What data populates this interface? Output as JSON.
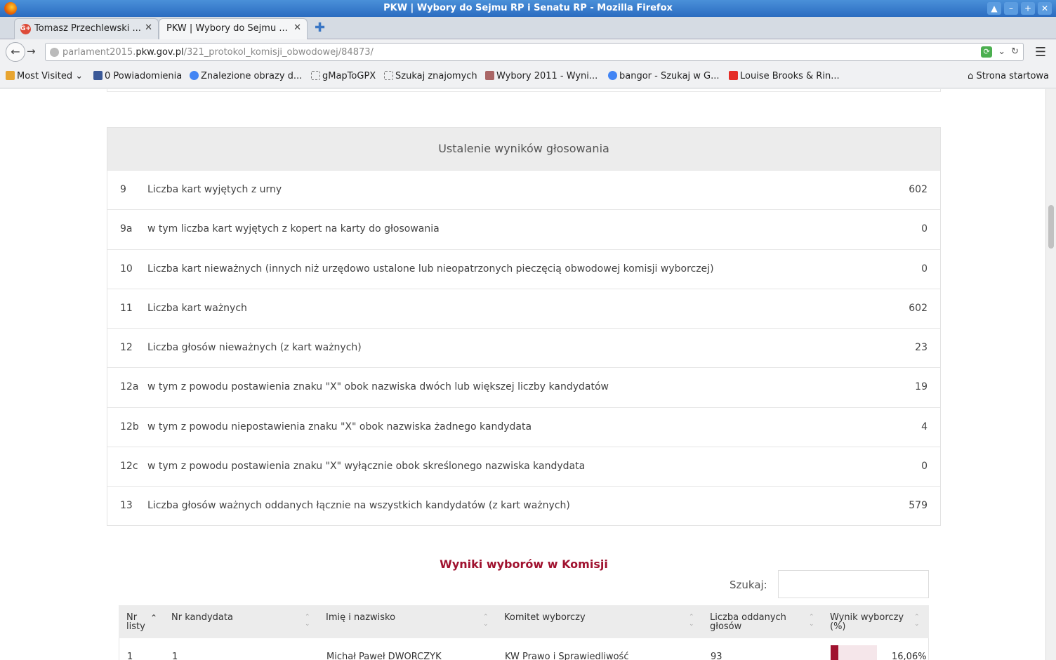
{
  "window": {
    "title": "PKW | Wybory do Sejmu RP i Senatu RP - Mozilla Firefox",
    "buttons": [
      "▲",
      "–",
      "+",
      "✕"
    ]
  },
  "tabs": [
    {
      "label": "Tomasz Przechlewski ...",
      "icon": "google-plus-icon",
      "close": "✕"
    },
    {
      "label": "PKW | Wybory do Sejmu ...",
      "icon": "none",
      "close": "✕"
    }
  ],
  "new_tab": "✚",
  "url": {
    "prefix": "parlament2015.",
    "domain": "pkw.gov.pl",
    "path": "/321_protokol_komisji_obwodowej/84873/"
  },
  "bookmarks": [
    {
      "label": "Most Visited",
      "icon": "folder-icon"
    },
    {
      "label": "0 Powiadomienia",
      "icon": "facebook-icon"
    },
    {
      "label": "Znalezione obrazy d...",
      "icon": "google-icon"
    },
    {
      "label": "gMapToGPX",
      "icon": "page-icon"
    },
    {
      "label": "Szukaj znajomych",
      "icon": "page-icon"
    },
    {
      "label": "Wybory 2011 - Wyni...",
      "icon": "pkw-icon"
    },
    {
      "label": "bangor - Szukaj w G...",
      "icon": "google-icon"
    },
    {
      "label": "Louise Brooks & Rin...",
      "icon": "youtube-icon"
    }
  ],
  "home_bookmark": "Strona startowa",
  "results": {
    "header": "Ustalenie wyników głosowania",
    "rows": [
      {
        "num": "9",
        "desc": "Liczba kart wyjętych z urny",
        "val": "602"
      },
      {
        "num": "9a",
        "desc": "w tym liczba kart wyjętych z kopert na karty do głosowania",
        "val": "0"
      },
      {
        "num": "10",
        "desc": "Liczba kart nieważnych (innych niż urzędowo ustalone lub nieopatrzonych pieczęcią obwodowej komisji wyborczej)",
        "val": "0"
      },
      {
        "num": "11",
        "desc": "Liczba kart ważnych",
        "val": "602"
      },
      {
        "num": "12",
        "desc": "Liczba głosów nieważnych (z kart ważnych)",
        "val": "23"
      },
      {
        "num": "12a",
        "desc": "w tym z powodu postawienia znaku \"X\" obok nazwiska dwóch lub większej liczby kandydatów",
        "val": "19"
      },
      {
        "num": "12b",
        "desc": "w tym z powodu niepostawienia znaku \"X\" obok nazwiska żadnego kandydata",
        "val": "4"
      },
      {
        "num": "12c",
        "desc": "w tym z powodu postawienia znaku \"X\" wyłącznie obok skreślonego nazwiska kandydata",
        "val": "0"
      },
      {
        "num": "13",
        "desc": "Liczba głosów ważnych oddanych łącznie na wszystkich kandydatów (z kart ważnych)",
        "val": "579"
      }
    ]
  },
  "election_results": {
    "title": "Wyniki wyborów w Komisji",
    "search_label": "Szukaj:",
    "columns": [
      "Nr listy",
      "Nr kandydata",
      "Imię i nazwisko",
      "Komitet wyborczy",
      "Liczba oddanych głosów",
      "Wynik wyborczy (%)"
    ],
    "first_row": {
      "nr_listy": "1",
      "nr_kandydata": "1",
      "name": "Michał Paweł DWORCZYK",
      "committee": "KW Prawo i Sprawiedliwość",
      "votes": "93",
      "percent": "16,06%",
      "percent_value": 16.06
    }
  }
}
